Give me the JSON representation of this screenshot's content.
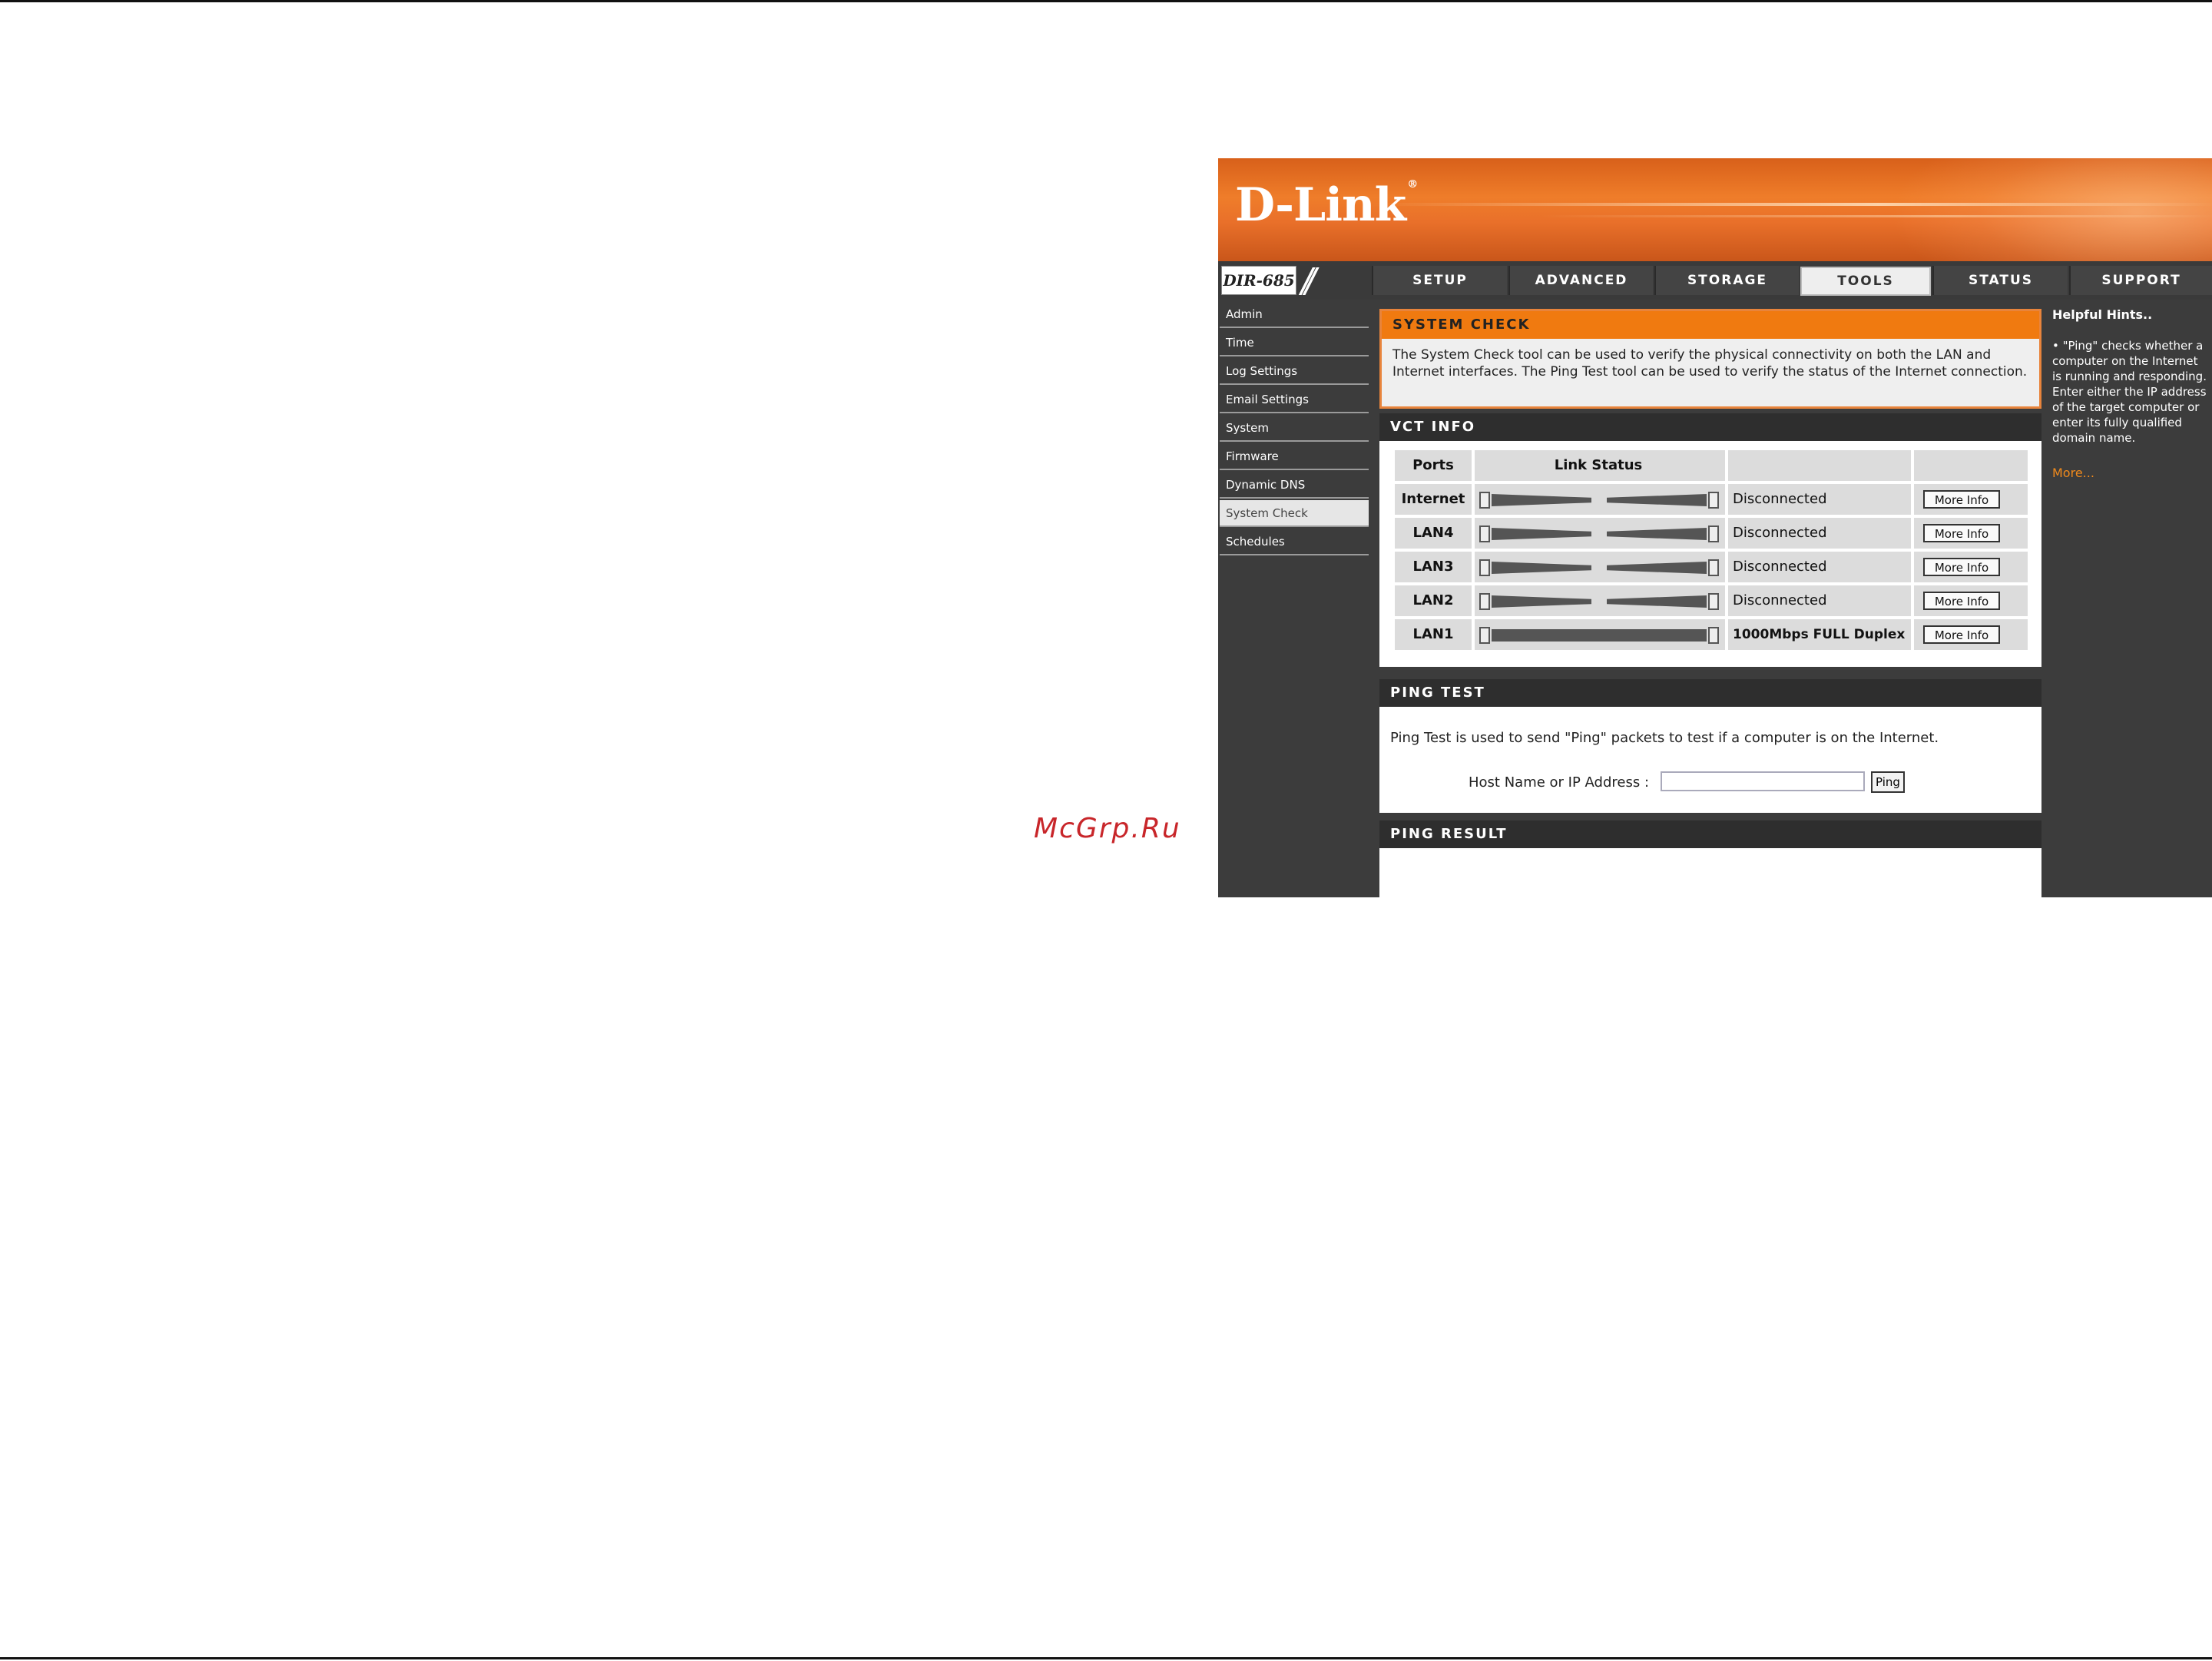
{
  "watermark": "McGrp.Ru",
  "brand": {
    "logo": "D-Link",
    "reg": "®",
    "model": "DIR-685",
    "model_slashes": "//"
  },
  "tabs": [
    {
      "label": "SETUP"
    },
    {
      "label": "ADVANCED"
    },
    {
      "label": "STORAGE"
    },
    {
      "label": "TOOLS",
      "active": true
    },
    {
      "label": "STATUS"
    },
    {
      "label": "SUPPORT"
    }
  ],
  "sidebar": {
    "items": [
      {
        "label": "Admin"
      },
      {
        "label": "Time"
      },
      {
        "label": "Log Settings"
      },
      {
        "label": "Email Settings"
      },
      {
        "label": "System"
      },
      {
        "label": "Firmware"
      },
      {
        "label": "Dynamic DNS"
      },
      {
        "label": "System Check",
        "active": true
      },
      {
        "label": "Schedules"
      }
    ]
  },
  "system_check": {
    "title": "SYSTEM CHECK",
    "description": "The System Check tool can be used to verify the physical connectivity on both the LAN and Internet interfaces. The Ping Test tool can be used to verify the status of the Internet connection."
  },
  "vct": {
    "title": "VCT INFO",
    "headers": {
      "ports": "Ports",
      "link_status": "Link Status"
    },
    "rows": [
      {
        "port": "Internet",
        "status": "Disconnected",
        "connected": false,
        "button": "More Info"
      },
      {
        "port": "LAN4",
        "status": "Disconnected",
        "connected": false,
        "button": "More Info"
      },
      {
        "port": "LAN3",
        "status": "Disconnected",
        "connected": false,
        "button": "More Info"
      },
      {
        "port": "LAN2",
        "status": "Disconnected",
        "connected": false,
        "button": "More Info"
      },
      {
        "port": "LAN1",
        "status": "1000Mbps FULL Duplex",
        "connected": true,
        "button": "More Info"
      }
    ]
  },
  "ping_test": {
    "title": "PING TEST",
    "description": "Ping Test is used to send \"Ping\" packets to test if a computer is on the Internet.",
    "host_label": "Host Name or IP Address :",
    "host_value": "",
    "button": "Ping"
  },
  "ping_result": {
    "title": "PING RESULT"
  },
  "hints": {
    "title": "Helpful Hints..",
    "body": "• \"Ping\" checks whether a computer on the Internet is running and responding. Enter either the IP address of the target computer or enter its fully qualified domain name.",
    "more": "More..."
  },
  "colors": {
    "accent": "#f07a10",
    "panel_dark": "#2e2e2e",
    "background_dark": "#3c3c3c",
    "brand_orange": "#e9702a"
  }
}
